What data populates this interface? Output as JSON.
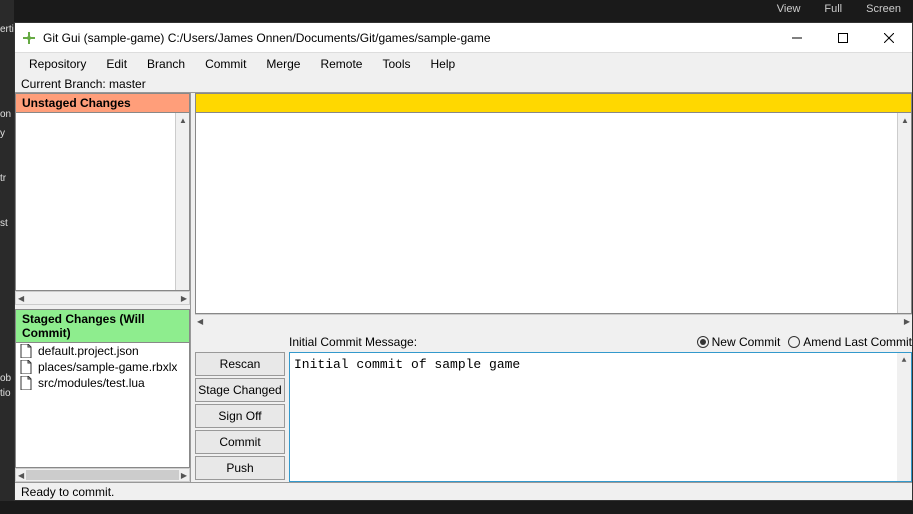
{
  "bg_top": {
    "view": "View",
    "full": "Full",
    "screen": "Screen"
  },
  "bg_left": [
    "erties",
    "on",
    "y",
    "tr",
    "st",
    "ob",
    "tio"
  ],
  "window": {
    "title": "Git Gui (sample-game) C:/Users/James Onnen/Documents/Git/games/sample-game"
  },
  "menu": [
    "Repository",
    "Edit",
    "Branch",
    "Commit",
    "Merge",
    "Remote",
    "Tools",
    "Help"
  ],
  "branch": {
    "label": "Current Branch:",
    "name": "master"
  },
  "panels": {
    "unstaged": "Unstaged Changes",
    "staged": "Staged Changes (Will Commit)"
  },
  "staged_files": [
    "default.project.json",
    "places/sample-game.rbxlx",
    "src/modules/test.lua"
  ],
  "buttons": {
    "rescan": "Rescan",
    "stage": "Stage Changed",
    "signoff": "Sign Off",
    "commit": "Commit",
    "push": "Push"
  },
  "commit": {
    "label": "Initial Commit Message:",
    "message": "Initial commit of sample game",
    "radio_new": "New Commit",
    "radio_amend": "Amend Last Commit"
  },
  "status": "Ready to commit."
}
